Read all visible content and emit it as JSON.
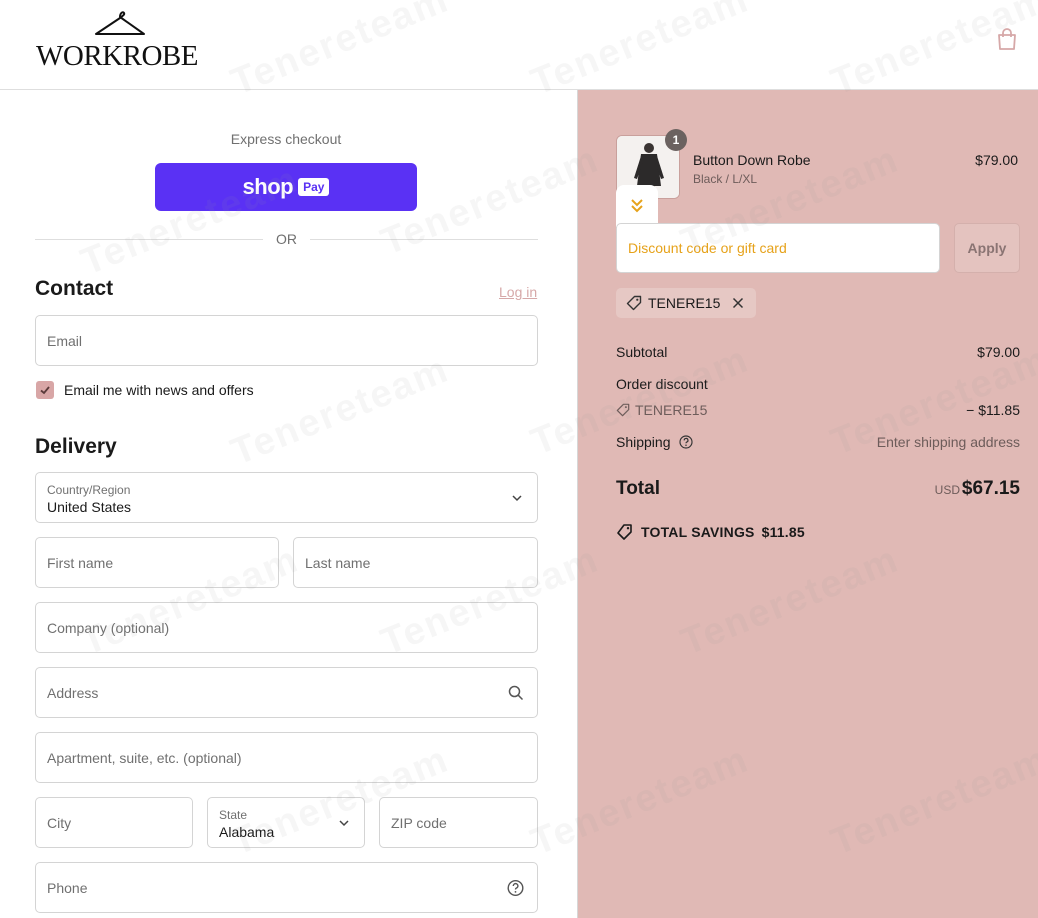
{
  "header": {
    "logo_text": "WORKROBE",
    "cart_icon": "shopping-bag-icon"
  },
  "express": {
    "label": "Express checkout",
    "shop_pay_word": "shop",
    "shop_pay_badge": "Pay",
    "or_text": "OR"
  },
  "contact": {
    "title": "Contact",
    "login_link": "Log in",
    "email_placeholder": "Email",
    "newsletter_label": "Email me with news and offers",
    "newsletter_checked": true
  },
  "delivery": {
    "title": "Delivery",
    "country_label": "Country/Region",
    "country_value": "United States",
    "first_name_placeholder": "First name",
    "last_name_placeholder": "Last name",
    "company_placeholder": "Company (optional)",
    "address_placeholder": "Address",
    "apartment_placeholder": "Apartment, suite, etc. (optional)",
    "city_placeholder": "City",
    "state_label": "State",
    "state_value": "Alabama",
    "zip_placeholder": "ZIP code",
    "phone_placeholder": "Phone"
  },
  "summary": {
    "item": {
      "name": "Button Down Robe",
      "variant": "Black / L/XL",
      "price": "$79.00",
      "quantity": "1"
    },
    "discount_placeholder": "Discount code or gift card",
    "apply_label": "Apply",
    "applied_code": "TENERE15",
    "subtotal_label": "Subtotal",
    "subtotal_value": "$79.00",
    "order_discount_label": "Order discount",
    "order_discount_code": "TENERE15",
    "order_discount_value": "− $11.85",
    "shipping_label": "Shipping",
    "shipping_value": "Enter shipping address",
    "total_label": "Total",
    "total_currency": "USD",
    "total_value": "$67.15",
    "savings_label": "TOTAL SAVINGS",
    "savings_value": "$11.85"
  },
  "watermark_text": "Tenereteam",
  "colors": {
    "summary_bg": "#e0b9b5",
    "shop_pay": "#5a31f4",
    "accent": "#d8a6a6",
    "discount_placeholder": "#e6a21a"
  }
}
